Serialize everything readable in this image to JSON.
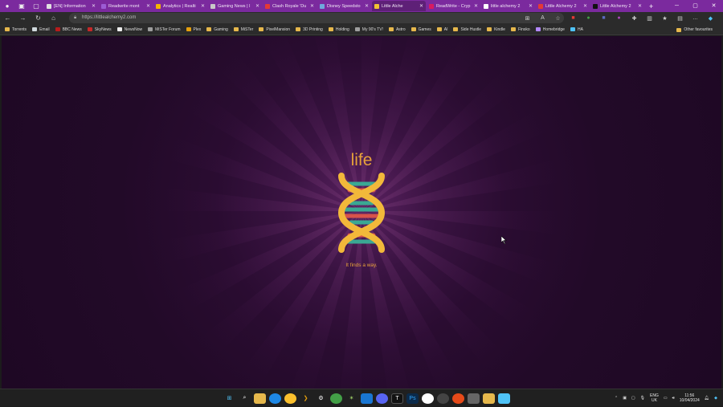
{
  "browser": {
    "tabs": [
      {
        "title": "[EN] Information",
        "color": "#e0e0e0",
        "active": false
      },
      {
        "title": "Readwrite mont",
        "color": "#9c5cd4",
        "active": false
      },
      {
        "title": "Analytics | Realti",
        "color": "#f4b400",
        "active": false
      },
      {
        "title": "Gaming News | I",
        "color": "#c8c8c8",
        "active": false
      },
      {
        "title": "Clash Royale 'Du",
        "color": "#e53935",
        "active": false
      },
      {
        "title": "Disney Speedsto",
        "color": "#6fa8dc",
        "active": false
      },
      {
        "title": "Little Alche",
        "color": "#f1c232",
        "active": true
      },
      {
        "title": "ReadWrite - Cryp",
        "color": "#d81b60",
        "active": false
      },
      {
        "title": "little alchemy 2",
        "color": "#ffffff",
        "active": false
      },
      {
        "title": "Little Alchemy 2",
        "color": "#e53935",
        "active": false
      },
      {
        "title": "Little Alchemy 2",
        "color": "#111111",
        "active": false
      }
    ],
    "url": "https://littlealchemy2.com",
    "bookmarks": [
      {
        "label": "Torrents",
        "color": "#e6b84c"
      },
      {
        "label": "Email",
        "color": "#cfd8dc"
      },
      {
        "label": "BBC News",
        "color": "#b71c1c"
      },
      {
        "label": "SkyNews",
        "color": "#c62828"
      },
      {
        "label": "NewsNow",
        "color": "#eeeeee"
      },
      {
        "label": "MiSTer Forum",
        "color": "#9e9e9e"
      },
      {
        "label": "Plex",
        "color": "#e5a00d"
      },
      {
        "label": "Gaming",
        "color": "#e6b84c"
      },
      {
        "label": "MiSTer",
        "color": "#e6b84c"
      },
      {
        "label": "PixelMansion",
        "color": "#e6b84c"
      },
      {
        "label": "3D Printing",
        "color": "#e6b84c"
      },
      {
        "label": "Holding",
        "color": "#e6b84c"
      },
      {
        "label": "My 90's TV!",
        "color": "#9e9e9e"
      },
      {
        "label": "Astro",
        "color": "#e6b84c"
      },
      {
        "label": "Games",
        "color": "#e6b84c"
      },
      {
        "label": "AI",
        "color": "#e6b84c"
      },
      {
        "label": "Side Hustle",
        "color": "#e6b84c"
      },
      {
        "label": "Kindle",
        "color": "#e6b84c"
      },
      {
        "label": "Finsko",
        "color": "#e6b84c"
      },
      {
        "label": "Homebridge",
        "color": "#b388ff"
      },
      {
        "label": "HA",
        "color": "#4fc3f7"
      }
    ],
    "other_favourites": "Other favourites"
  },
  "game": {
    "element_name": "life",
    "description": "It finds a way.",
    "colors": {
      "accent": "#e6a13a",
      "helix": "#f2b83a",
      "teal": "#3aa893",
      "red": "#d8524a",
      "bg": "#250a2b"
    }
  },
  "taskbar": {
    "lang": "ENG",
    "region": "UK",
    "time": "11:56",
    "date": "10/04/2024"
  }
}
